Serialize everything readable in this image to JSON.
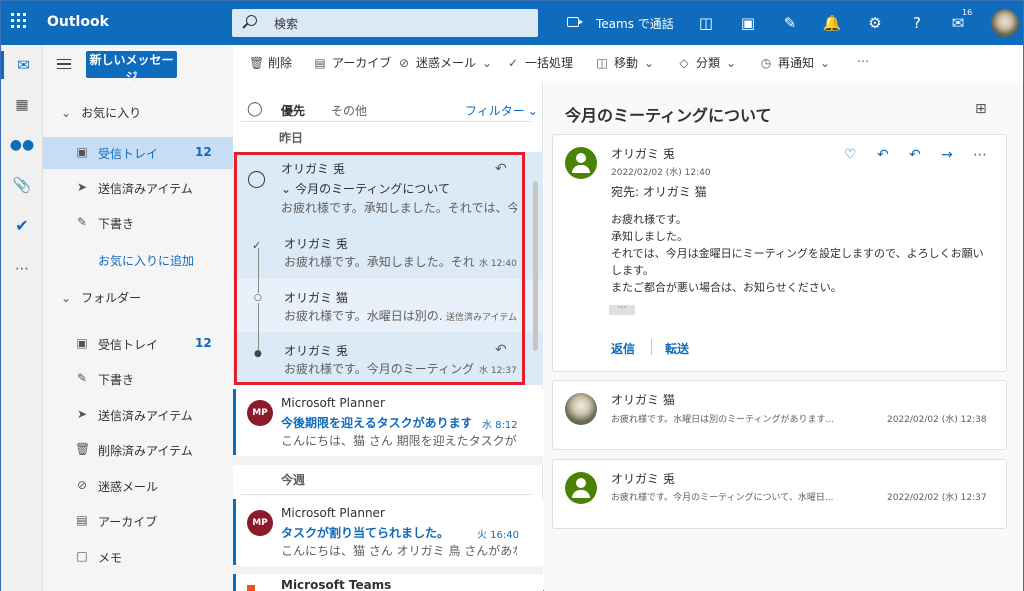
{
  "app": {
    "name": "Outlook"
  },
  "search": {
    "placeholder": "検索"
  },
  "topbar": {
    "teams_label": "Teams で通話",
    "notification_count": "16"
  },
  "compose": {
    "label": "新しいメッセージ"
  },
  "commands": [
    {
      "label": "削除",
      "icon": "trash-icon"
    },
    {
      "label": "アーカイブ",
      "icon": "archive-icon"
    },
    {
      "label": "迷惑メール",
      "icon": "block-icon"
    },
    {
      "label": "一括処理",
      "icon": "broom-icon"
    },
    {
      "label": "移動",
      "icon": "folder-move-icon"
    },
    {
      "label": "分類",
      "icon": "tag-icon"
    },
    {
      "label": "再通知",
      "icon": "clock-icon"
    }
  ],
  "folders": {
    "favorites_header": "お気に入り",
    "favorites": [
      {
        "label": "受信トレイ",
        "count": "12"
      },
      {
        "label": "送信済みアイテム",
        "count": ""
      },
      {
        "label": "下書き",
        "count": ""
      }
    ],
    "add_favorite": "お気に入りに追加",
    "folders_header": "フォルダー",
    "items": [
      {
        "label": "受信トレイ",
        "count": "12"
      },
      {
        "label": "下書き",
        "count": ""
      },
      {
        "label": "送信済みアイテム",
        "count": ""
      },
      {
        "label": "削除済みアイテム",
        "count": ""
      },
      {
        "label": "迷惑メール",
        "count": ""
      },
      {
        "label": "アーカイブ",
        "count": ""
      },
      {
        "label": "メモ",
        "count": ""
      }
    ]
  },
  "list": {
    "tab_focused": "優先",
    "tab_other": "その他",
    "filter": "フィルター",
    "group_yesterday": "昨日",
    "group_this_week": "今週",
    "thread": {
      "sender": "オリガミ 兎",
      "subject": "今月のミーティングについて",
      "preview": "お疲れ様です。承知しました。それでは、今月...",
      "children": [
        {
          "sender": "オリガミ 兎",
          "preview": "お疲れ様です。承知しました。それで...",
          "meta": "水 12:40"
        },
        {
          "sender": "オリガミ 猫",
          "preview": "お疲れ様です。水曜日は別の...",
          "meta": "送信済みアイテム"
        },
        {
          "sender": "オリガミ 兎",
          "preview": "お疲れ様です。今月のミーティングに...",
          "meta": "水 12:37"
        }
      ]
    },
    "planner1": {
      "sender": "Microsoft Planner",
      "subject": "今後期限を迎えるタスクがあります。",
      "time": "水 8:12",
      "preview": "こんにちは、猫 さん 期限を迎えたタスクが Mic...",
      "initials": "MP"
    },
    "planner2": {
      "sender": "Microsoft Planner",
      "subject": "タスクが割り当てられました。",
      "time": "火 16:40",
      "preview": "こんにちは、猫 さん オリガミ 鳥 さんがあなたに...",
      "initials": "MP"
    },
    "teams": {
      "sender": "Microsoft Teams"
    }
  },
  "reading": {
    "title": "今月のミーティングについて",
    "main": {
      "sender": "オリガミ 兎",
      "date": "2022/02/02 (水) 12:40",
      "to": "宛先: オリガミ 猫",
      "body": [
        "お疲れ様です。",
        "承知しました。",
        "それでは、今月は金曜日にミーティングを設定しますので、よろしくお願い",
        "します。",
        "またご都合が悪い場合は、お知らせください。"
      ],
      "reply": "返信",
      "forward": "転送"
    },
    "second": {
      "sender": "オリガミ 猫",
      "preview": "お疲れ様です。水曜日は別のミーティングがあります...",
      "date": "2022/02/02 (水) 12:38"
    },
    "third": {
      "sender": "オリガミ 兎",
      "preview": "お疲れ様です。今月のミーティングについて、水曜日...",
      "date": "2022/02/02 (水) 12:37"
    }
  }
}
